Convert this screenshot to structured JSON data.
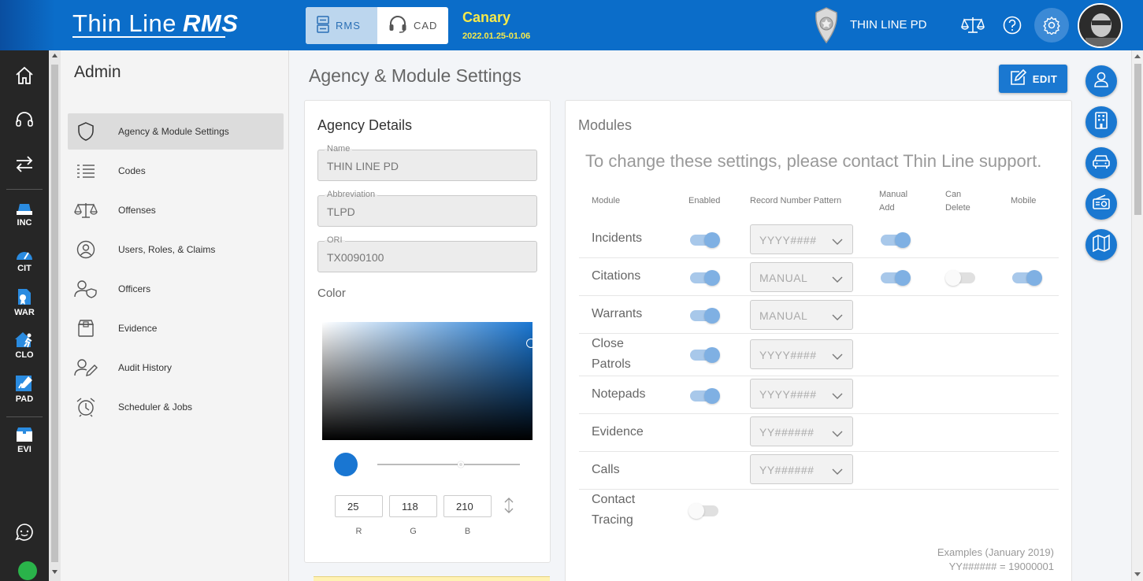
{
  "header": {
    "logo_main": "Thin Line",
    "logo_sub": "RMS",
    "modules": [
      {
        "label": "RMS",
        "icon": "server-icon"
      },
      {
        "label": "CAD",
        "icon": "headset-icon"
      }
    ],
    "env_name": "Canary",
    "env_version": "2022.01.25-01.06",
    "agency_name": "THIN LINE PD",
    "icons": [
      "scales-icon",
      "help-icon",
      "settings-icon"
    ],
    "colors": {
      "primary": "#0b6dc9",
      "env_text": "#f6e94a"
    }
  },
  "left_nav": {
    "items": [
      {
        "label": "",
        "icon": "home-icon"
      },
      {
        "label": "",
        "icon": "headset-icon"
      },
      {
        "label": "",
        "icon": "transfer-icon"
      },
      {
        "label": "INC",
        "icon": "incident-icon"
      },
      {
        "label": "CIT",
        "icon": "citation-icon"
      },
      {
        "label": "WAR",
        "icon": "warrant-icon"
      },
      {
        "label": "CLO",
        "icon": "close-patrol-icon"
      },
      {
        "label": "PAD",
        "icon": "notepad-icon"
      },
      {
        "label": "EVI",
        "icon": "evidence-icon"
      }
    ],
    "bottom_icon": "chat-icon",
    "status": "online"
  },
  "admin": {
    "title": "Admin",
    "items": [
      {
        "label": "Agency & Module Settings",
        "icon": "shield-icon",
        "active": true
      },
      {
        "label": "Codes",
        "icon": "list-icon"
      },
      {
        "label": "Offenses",
        "icon": "scales-icon"
      },
      {
        "label": "Users, Roles, & Claims",
        "icon": "user-circle-icon"
      },
      {
        "label": "Officers",
        "icon": "officer-icon"
      },
      {
        "label": "Evidence",
        "icon": "box-icon"
      },
      {
        "label": "Audit History",
        "icon": "user-edit-icon"
      },
      {
        "label": "Scheduler & Jobs",
        "icon": "alarm-clock-icon"
      }
    ]
  },
  "page": {
    "title": "Agency & Module Settings",
    "edit_label": "EDIT"
  },
  "agency_details": {
    "heading": "Agency Details",
    "fields": [
      {
        "label": "Name",
        "value": "THIN LINE PD"
      },
      {
        "label": "Abbreviation",
        "value": "TLPD"
      },
      {
        "label": "ORI",
        "value": "TX0090100"
      }
    ],
    "color_label": "Color",
    "color_hex": "#1976d2",
    "rgb": [
      {
        "label": "R",
        "value": "25"
      },
      {
        "label": "G",
        "value": "118"
      },
      {
        "label": "B",
        "value": "210"
      }
    ]
  },
  "modules": {
    "heading": "Modules",
    "notice": "To change these settings, please contact Thin Line support.",
    "columns": [
      "Module",
      "Enabled",
      "Record Number Pattern",
      "Manual Add",
      "Can Delete",
      "Mobile"
    ],
    "rows": [
      {
        "name": "Incidents",
        "enabled": true,
        "pattern": "YYYY####",
        "manual_add": true,
        "can_delete": null,
        "mobile": null
      },
      {
        "name": "Citations",
        "enabled": true,
        "pattern": "MANUAL",
        "manual_add": true,
        "can_delete": false,
        "mobile": true
      },
      {
        "name": "Warrants",
        "enabled": true,
        "pattern": "MANUAL",
        "manual_add": null,
        "can_delete": null,
        "mobile": null
      },
      {
        "name": "Close Patrols",
        "enabled": true,
        "pattern": "YYYY####",
        "manual_add": null,
        "can_delete": null,
        "mobile": null
      },
      {
        "name": "Notepads",
        "enabled": true,
        "pattern": "YYYY####",
        "manual_add": null,
        "can_delete": null,
        "mobile": null
      },
      {
        "name": "Evidence",
        "enabled": null,
        "pattern": "YY######",
        "manual_add": null,
        "can_delete": null,
        "mobile": null
      },
      {
        "name": "Calls",
        "enabled": null,
        "pattern": "YY######",
        "manual_add": null,
        "can_delete": null,
        "mobile": null
      },
      {
        "name": "Contact Tracing",
        "enabled": false,
        "pattern": null,
        "manual_add": null,
        "can_delete": null,
        "mobile": null
      }
    ],
    "examples_title": "Examples (January 2019)",
    "examples": [
      "YY###### = 19000001"
    ]
  },
  "right_bar": {
    "icons": [
      "person-icon",
      "building-icon",
      "car-icon",
      "radio-icon",
      "map-icon"
    ]
  }
}
